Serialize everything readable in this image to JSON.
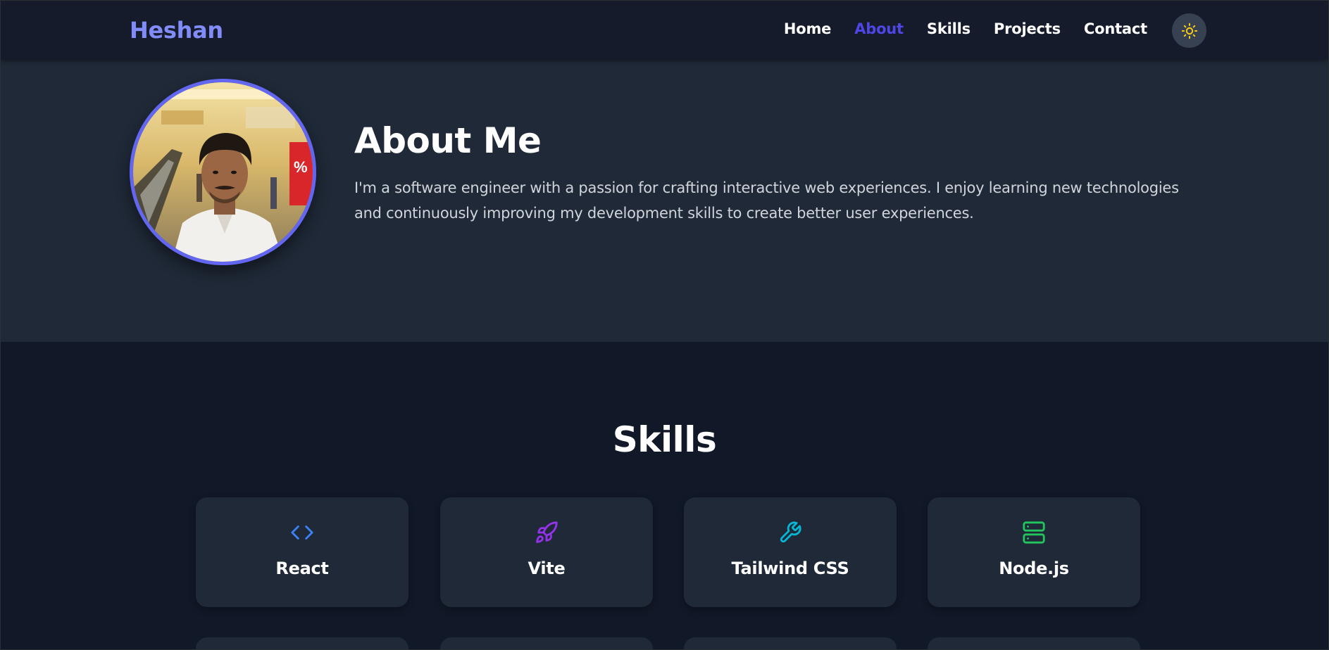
{
  "nav": {
    "brand": "Heshan",
    "links": [
      {
        "label": "Home",
        "active": false
      },
      {
        "label": "About",
        "active": true
      },
      {
        "label": "Skills",
        "active": false
      },
      {
        "label": "Projects",
        "active": false
      },
      {
        "label": "Contact",
        "active": false
      }
    ],
    "theme_toggle_icon": "sun-icon"
  },
  "about": {
    "title": "About Me",
    "text": "I'm a software engineer with a passion for crafting interactive web experiences. I enjoy learning new technologies and continuously improving my development skills to create better user experiences.",
    "avatar": "profile-photo"
  },
  "skills": {
    "title": "Skills",
    "items": [
      {
        "name": "React",
        "icon": "code-icon",
        "color": "#3b82f6"
      },
      {
        "name": "Vite",
        "icon": "rocket-icon",
        "color": "#9333ea"
      },
      {
        "name": "Tailwind CSS",
        "icon": "wrench-icon",
        "color": "#06b6d4"
      },
      {
        "name": "Node.js",
        "icon": "server-icon",
        "color": "#22c55e"
      }
    ]
  },
  "colors": {
    "accent": "#6366f1",
    "brand": "#818cf8",
    "active_link": "#5046e5",
    "sun": "#facc15"
  }
}
